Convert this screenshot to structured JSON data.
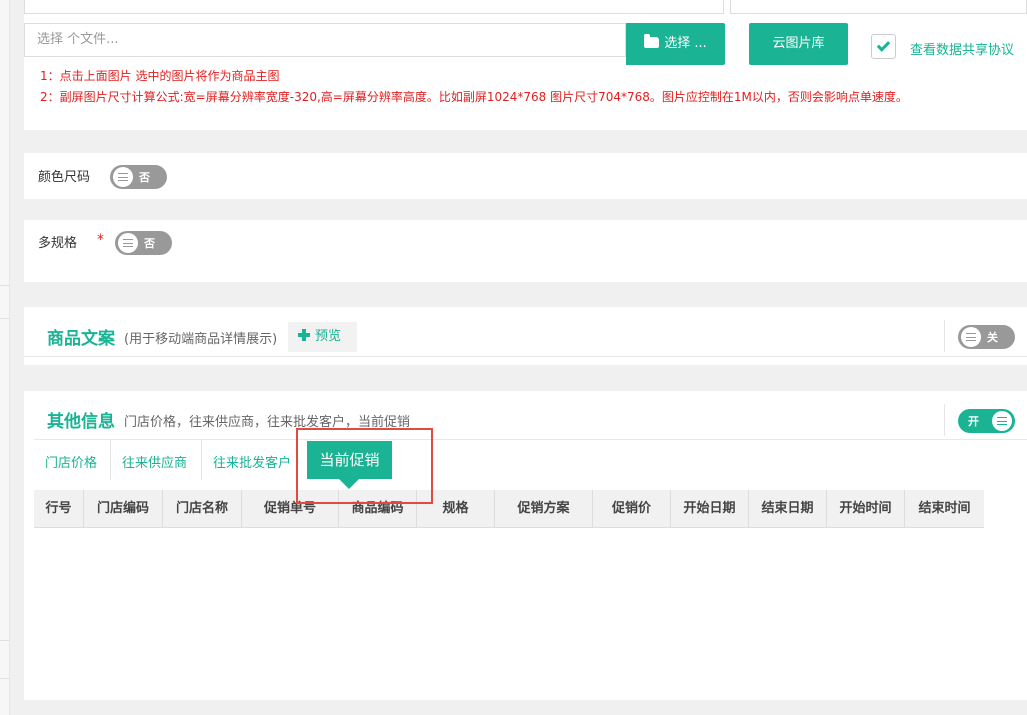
{
  "upload": {
    "file_placeholder": "选择 个文件...",
    "select_button": "选择 ...",
    "cloud_button": "云图片库",
    "share_checked": true,
    "share_link": "查看数据共享协议",
    "note_1": "1：点击上面图片 选中的图片将作为商品主图",
    "note_2": "2：副屏图片尺寸计算公式:宽=屏幕分辨率宽度-320,高=屏幕分辨率高度。比如副屏1024*768 图片尺寸704*768。图片应控制在1M以内，否则会影响点单速度。"
  },
  "color_size": {
    "label": "颜色尺码",
    "toggle": "否"
  },
  "multi_spec": {
    "label": "多规格",
    "required_mark": "*",
    "toggle": "否"
  },
  "product_copy": {
    "title": "商品文案",
    "subtitle": "(用于移动端商品详情展示)",
    "preview_button": "预览",
    "toggle": "关"
  },
  "other_info": {
    "title": "其他信息",
    "subtitle": "门店价格，往来供应商，往来批发客户，当前促销",
    "toggle": "开",
    "tabs": [
      "门店价格",
      "往来供应商",
      "往来批发客户",
      "当前促销"
    ],
    "active_tab": "当前促销",
    "columns": [
      "行号",
      "门店编码",
      "门店名称",
      "促销单号",
      "商品编码",
      "规格",
      "促销方案",
      "促销价",
      "开始日期",
      "结束日期",
      "开始时间",
      "结束时间"
    ]
  },
  "colors": {
    "accent": "#1ab394",
    "danger": "#e02020",
    "highlight_box": "#e04a3f"
  }
}
